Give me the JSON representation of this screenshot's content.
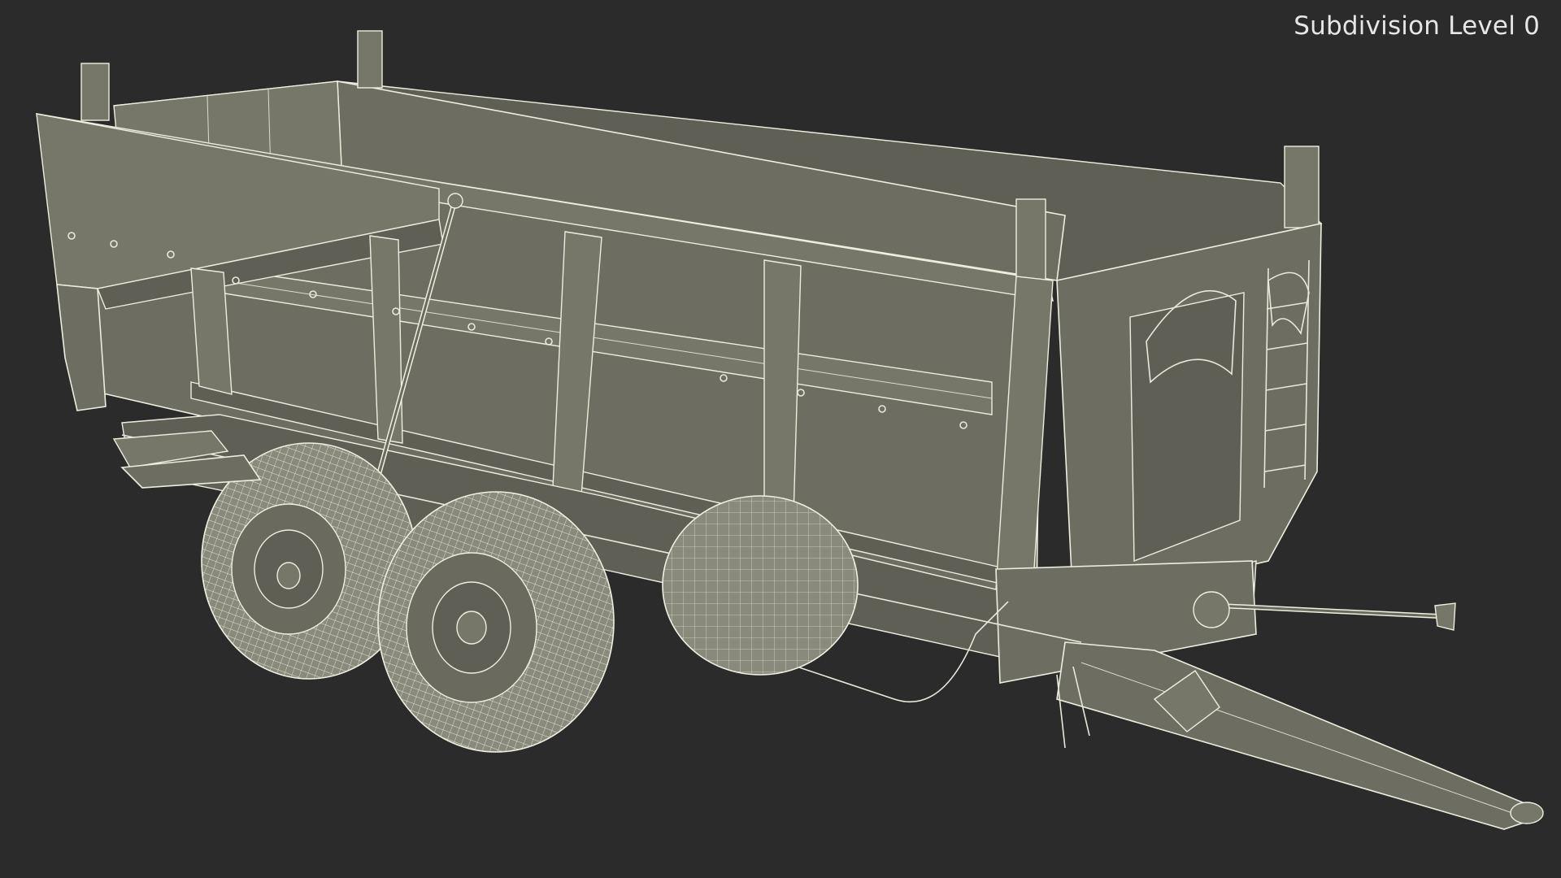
{
  "viewport": {
    "overlay_label": "Subdivision Level 0",
    "background_color": "#2b2b2b",
    "subject": "agricultural-tipping-trailer-wireframe"
  }
}
